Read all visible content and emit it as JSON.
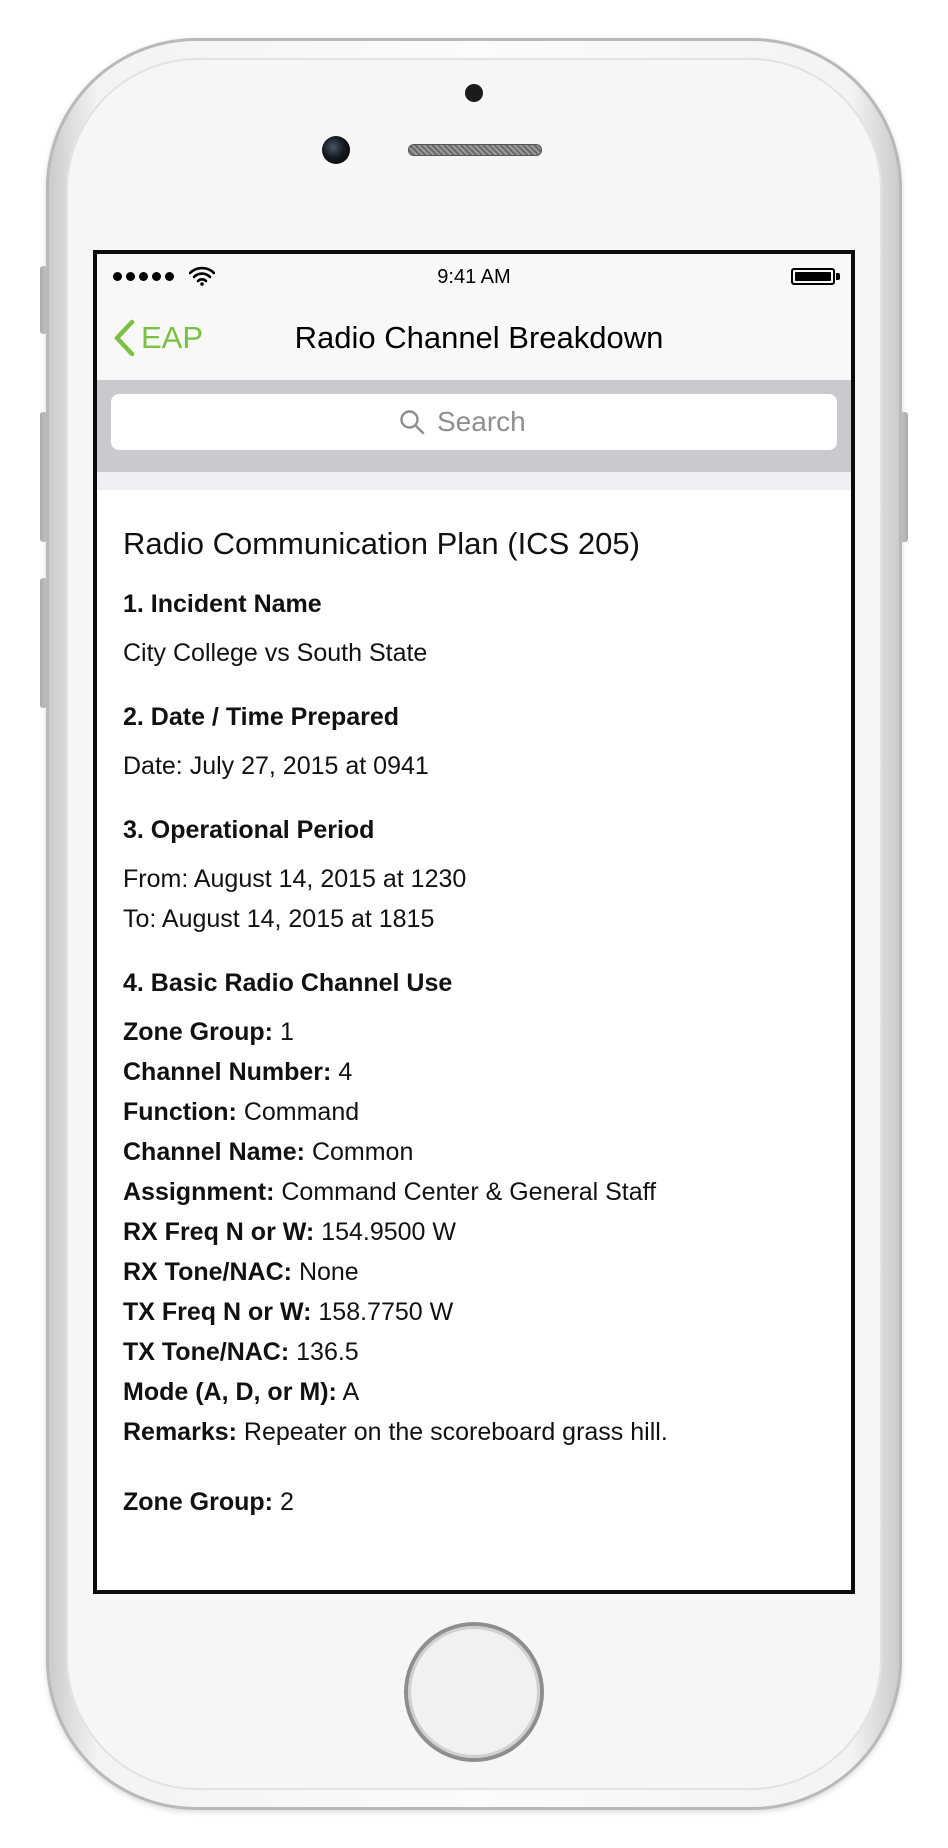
{
  "status_bar": {
    "time": "9:41 AM"
  },
  "nav": {
    "back_label": "EAP",
    "title": "Radio Channel Breakdown"
  },
  "search": {
    "placeholder": "Search"
  },
  "document": {
    "title": "Radio Communication Plan (ICS 205)",
    "incident": {
      "heading": "1. Incident Name",
      "value": "City College vs South State"
    },
    "prepared": {
      "heading": "2. Date / Time Prepared",
      "value": "Date: July 27, 2015 at 0941"
    },
    "period": {
      "heading": "3. Operational Period",
      "from": "From: August 14, 2015 at 1230",
      "to": "To: August 14, 2015 at 1815"
    },
    "channel_use": {
      "heading": "4. Basic Radio Channel Use",
      "entries": [
        {
          "label": "Zone Group:",
          "value": "1"
        },
        {
          "label": "Channel Number:",
          "value": "4"
        },
        {
          "label": "Function:",
          "value": "Command"
        },
        {
          "label": "Channel Name:",
          "value": "Common"
        },
        {
          "label": "Assignment:",
          "value": "Command Center & General Staff"
        },
        {
          "label": "RX Freq N or W:",
          "value": "154.9500 W"
        },
        {
          "label": "RX Tone/NAC:",
          "value": "None"
        },
        {
          "label": "TX Freq N or W:",
          "value": "158.7750 W"
        },
        {
          "label": "TX Tone/NAC:",
          "value": "136.5"
        },
        {
          "label": "Mode (A, D, or M):",
          "value": "A"
        },
        {
          "label": "Remarks:",
          "value": "Repeater on the scoreboard grass hill."
        }
      ],
      "next_entry": {
        "label": "Zone Group:",
        "value": "2"
      }
    }
  },
  "colors": {
    "accent": "#7ac142",
    "search_bar_bg": "#c9c9ce",
    "placeholder": "#8e8e93"
  }
}
